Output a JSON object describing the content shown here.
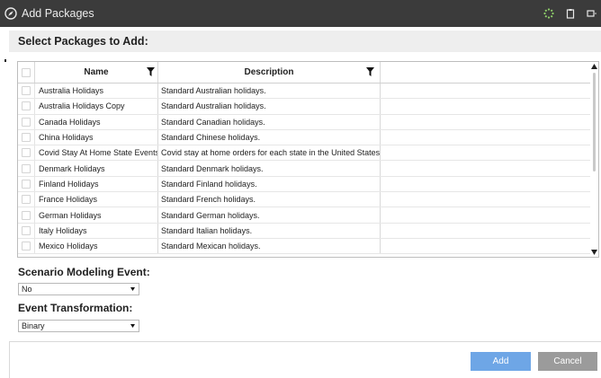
{
  "window": {
    "title": "Add Packages"
  },
  "header": {
    "title": "Select Packages to Add:"
  },
  "grid": {
    "columns": [
      "Name",
      "Description"
    ],
    "rows": [
      {
        "name": "Australia Holidays",
        "description": "Standard Australian holidays."
      },
      {
        "name": "Australia Holidays Copy",
        "description": "Standard Australian holidays."
      },
      {
        "name": "Canada Holidays",
        "description": "Standard Canadian holidays."
      },
      {
        "name": "China Holidays",
        "description": "Standard Chinese holidays."
      },
      {
        "name": "Covid Stay At Home State Events",
        "description": "Covid stay at home orders for each state in the United States."
      },
      {
        "name": "Denmark Holidays",
        "description": "Standard Denmark holidays."
      },
      {
        "name": "Finland Holidays",
        "description": "Standard Finland holidays."
      },
      {
        "name": "France Holidays",
        "description": "Standard French holidays."
      },
      {
        "name": "German Holidays",
        "description": "Standard German holidays."
      },
      {
        "name": "Italy Holidays",
        "description": "Standard Italian holidays."
      },
      {
        "name": "Mexico Holidays",
        "description": "Standard Mexican holidays."
      }
    ]
  },
  "scenario_modeling": {
    "label": "Scenario Modeling Event:",
    "value": "No"
  },
  "event_transformation": {
    "label": "Event Transformation:",
    "value": "Binary"
  },
  "footer": {
    "add_label": "Add",
    "cancel_label": "Cancel"
  },
  "colors": {
    "titlebar": "#3b3b3b",
    "add_button": "#6ea6e6",
    "cancel_button": "#9b9b9b",
    "header_band": "#eeeeee"
  },
  "icons": {
    "app": "compass-icon",
    "loading": "spinner-icon",
    "restore": "window-icon",
    "close": "close-icon",
    "filter": "filter-icon"
  }
}
